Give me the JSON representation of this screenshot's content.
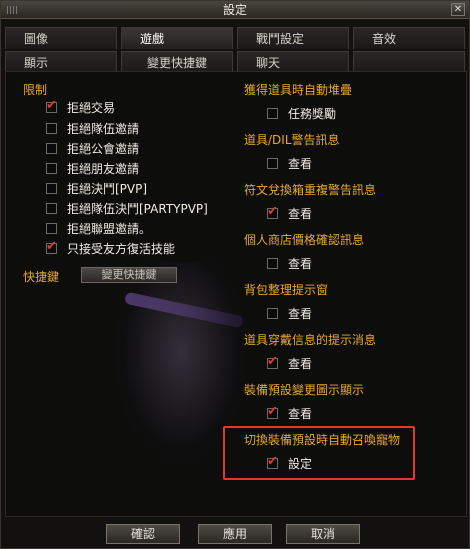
{
  "window": {
    "title": "設定",
    "close_symbol": "✕"
  },
  "tabs_row1": [
    {
      "label": "圖像"
    },
    {
      "label": "遊戲"
    },
    {
      "label": "戰鬥設定"
    },
    {
      "label": "音效"
    }
  ],
  "tabs_row2": [
    {
      "label": "顯示"
    },
    {
      "label": "變更快捷鍵"
    },
    {
      "label": "聊天"
    },
    {
      "label": ""
    }
  ],
  "left": {
    "limit_title": "限制",
    "items": [
      {
        "label": "拒絕交易",
        "checked": true
      },
      {
        "label": "拒絕隊伍邀請",
        "checked": false
      },
      {
        "label": "拒絕公會邀請",
        "checked": false
      },
      {
        "label": "拒絕朋友邀請",
        "checked": false
      },
      {
        "label": "拒絕決鬥[PVP]",
        "checked": false
      },
      {
        "label": "拒絕隊伍決鬥[PARTYPVP]",
        "checked": false
      },
      {
        "label": "拒絕聯盟邀請。",
        "checked": false
      },
      {
        "label": "只接受友方復活技能",
        "checked": true
      }
    ],
    "hotkey_title": "快捷鍵",
    "hotkey_button": "變更快捷鍵"
  },
  "right": {
    "sections": [
      {
        "title": "獲得道具時自動堆疊",
        "option": "任務獎勵",
        "checked": false
      },
      {
        "title": "道具/DIL警告訊息",
        "option": "查看",
        "checked": false
      },
      {
        "title": "符文兌換箱重複警告訊息",
        "option": "查看",
        "checked": true
      },
      {
        "title": "個人商店價格確認訊息",
        "option": "查看",
        "checked": false
      },
      {
        "title": "背包整理提示窗",
        "option": "查看",
        "checked": false
      },
      {
        "title": "道具穿戴信息的提示消息",
        "option": "查看",
        "checked": true
      },
      {
        "title": "裝備預設變更圖示顯示",
        "option": "查看",
        "checked": true
      },
      {
        "title": "切換裝備預設時自動召喚寵物",
        "option": "設定",
        "checked": true
      }
    ]
  },
  "buttons": {
    "confirm": "確認",
    "apply": "應用",
    "cancel": "取消"
  },
  "colors": {
    "section_title": "#e6a830",
    "check": "#e03a2c",
    "highlight_border": "#e03a2c"
  }
}
